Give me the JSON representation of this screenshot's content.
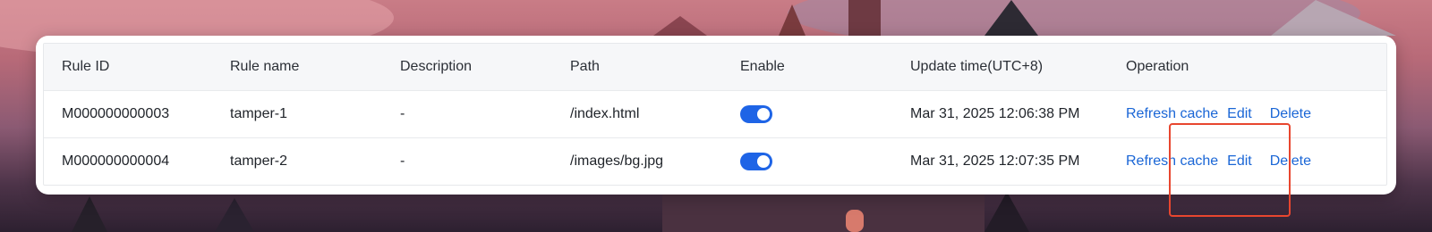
{
  "table": {
    "headers": [
      "Rule ID",
      "Rule name",
      "Description",
      "Path",
      "Enable",
      "Update time(UTC+8)",
      "Operation"
    ],
    "rows": [
      {
        "rule_id": "M000000000003",
        "rule_name": "tamper-1",
        "description": "-",
        "path": "/index.html",
        "enabled": true,
        "update_time": "Mar 31, 2025 12:06:38 PM",
        "ops": {
          "refresh": "Refresh cache",
          "edit": "Edit",
          "delete": "Delete"
        }
      },
      {
        "rule_id": "M000000000004",
        "rule_name": "tamper-2",
        "description": "-",
        "path": "/images/bg.jpg",
        "enabled": true,
        "update_time": "Mar 31, 2025 12:07:35 PM",
        "ops": {
          "refresh": "Refresh cache",
          "edit": "Edit",
          "delete": "Delete"
        }
      }
    ]
  },
  "colors": {
    "accent": "#1a66d6",
    "toggle_on": "#1e64e6",
    "highlight": "#e8462f"
  }
}
